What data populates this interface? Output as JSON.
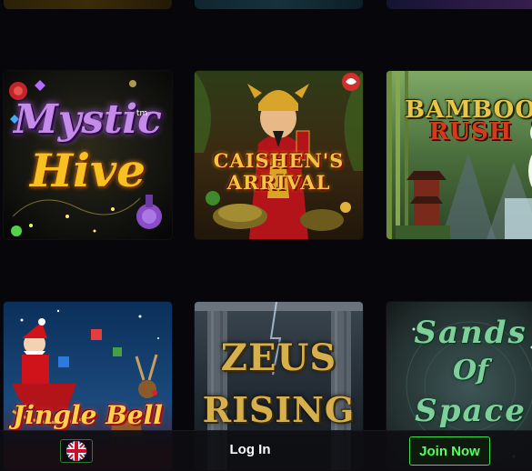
{
  "games": [
    {
      "id": "mystic-hive",
      "title_line1": "Mystic",
      "title_line2": "Hive",
      "title_mark": "tm"
    },
    {
      "id": "caishens-arrival",
      "title_line1": "CAISHEN'S",
      "title_line2": "ARRIVAL"
    },
    {
      "id": "bamboo-rush",
      "title_line1": "BAMBOO",
      "title_line2": "RUSH"
    },
    {
      "id": "jingle-bells",
      "title_line1": "Jingle Bell"
    },
    {
      "id": "zeus-rising",
      "title_line1": "ZEUS",
      "title_line2": "RISING"
    },
    {
      "id": "sands-of-space",
      "title_line1": "Sands",
      "title_line2": "Of",
      "title_line3": "Space"
    }
  ],
  "bottom_bar": {
    "language_flag": "uk-flag-icon",
    "login_label": "Log In",
    "join_label": "Join Now"
  },
  "colors": {
    "background": "#07070b",
    "join_green": "#56ff5e",
    "bar_bg": "#0e0e12"
  }
}
